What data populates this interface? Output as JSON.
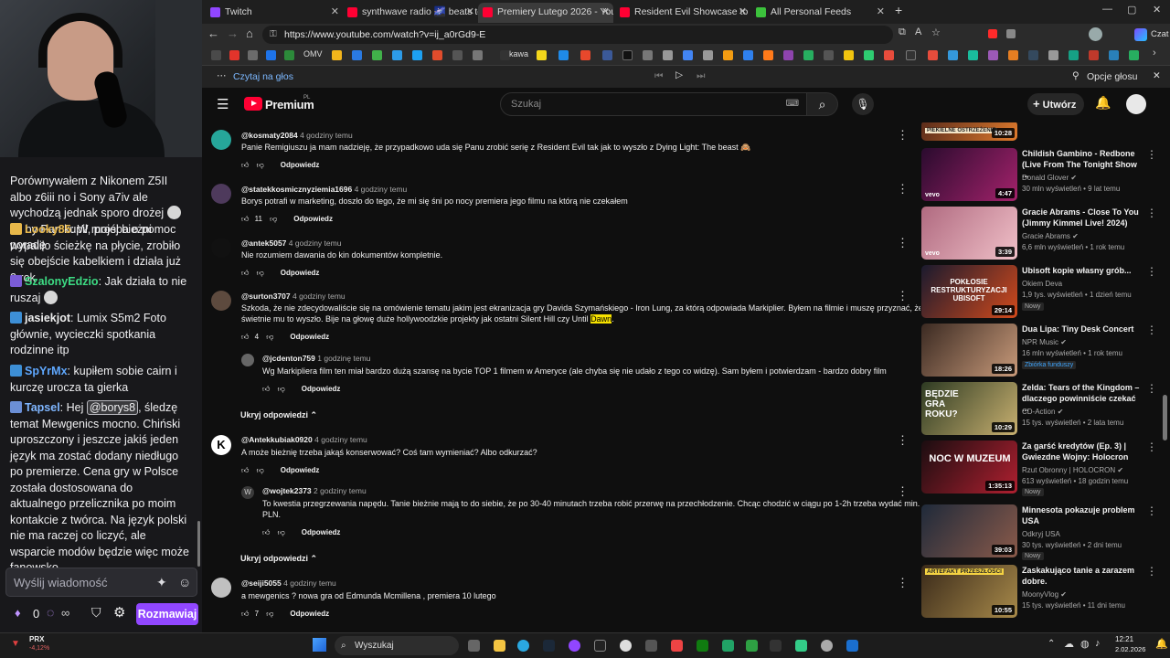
{
  "browser": {
    "tabs": [
      {
        "title": "Twitch",
        "color": "#9146ff"
      },
      {
        "title": "synthwave radio 🌌 beats to",
        "color": "#ff0033"
      },
      {
        "title": "Premiery Lutego 2026 - YouTube",
        "color": "#ff0033"
      },
      {
        "title": "Resident Evil Showcase to nieśmi",
        "color": "#ff0033"
      },
      {
        "title": "All Personal Feeds",
        "color": "#3cc23c"
      }
    ],
    "url": "https://www.youtube.com/watch?v=ij_a0rGd9-E",
    "bookmarks": [
      "OMV",
      "kawa"
    ],
    "read_aloud": "Czytaj na głos",
    "voice_options": "Opcje głosu",
    "profile_label": "Czat"
  },
  "twitch": {
    "chat": [
      {
        "user": "",
        "user_color": "#efeff1",
        "text": "Porównywałem z Nikonem Z5II albo z6iii no i Sony a7iv ale wychodzą jednak sporo drożej",
        "text2": " co by Pan kupił, prośba o pomoc poradę"
      },
      {
        "user": "Looky85",
        "user_color": "#e8b84a",
        "text": ": W mojej bieżni wypaliło ścieżkę na płycie, zrobiło się obejście kabelkiem i działa już 2 rok"
      },
      {
        "user": "SzalonyEdzio",
        "user_color": "#3ddc84",
        "text": ": Jak działa to nie ruszaj"
      },
      {
        "user": "jasiekjot",
        "user_color": "#eeeeee",
        "text": ": Lumix S5m2 Foto głównie, wycieczki spotkania rodzinne itp"
      },
      {
        "user": "SpYrMx",
        "user_color": "#5fa8ff",
        "text": ": kupiłem sobie cairn i kurczę urocza ta gierka"
      },
      {
        "user": "Tapsel",
        "user_color": "#7fb6ff",
        "text": ": Hej ",
        "mention": "@borys8",
        "text2": ", śledzę temat Mewgenics mocno. Chiński uproszczony i jeszcze jakiś jeden język ma zostać dodany niedługo po premierze. Cena gry w Polsce została dostosowana do aktualnego przelicznika po moim kontakcie z twórca. Na język polski nie ma raczej co liczyć, ale wsparcie modów będzie więc może fanowsko."
      }
    ],
    "input_placeholder": "Wyślij wiadomość",
    "points": "0",
    "chat_button": "Rozmawiaj"
  },
  "youtube": {
    "brand": "Premium",
    "brand_sup": "PL",
    "search_placeholder": "Szukaj",
    "create_label": "Utwórz",
    "comments": [
      {
        "author": "@kosmaty2084",
        "time": "4 godziny temu",
        "text": [
          "Panie Remigiuszu ja mam nadzieję, że przypadkowo uda się Panu zrobić serię z Resident Evil tak jak to wyszło z Dying Light: The beast 🙈"
        ],
        "likes": "",
        "reply": "Odpowiedz",
        "avatar": "#26a69a"
      },
      {
        "author": "@statekkosmicznyziemia1696",
        "time": "4 godziny temu",
        "text": [
          "Borys potrafi w marketing, doszło do tego, że mi się śni po nocy premiera jego filmu na którą nie czekałem"
        ],
        "likes": "11",
        "reply": "Odpowiedz",
        "avatar": "#4e3a5c"
      },
      {
        "author": "@antek5057",
        "time": "4 godziny temu",
        "text": [
          "Nie rozumiem dawania do kin dokumentów kompletnie."
        ],
        "likes": "",
        "reply": "Odpowiedz",
        "avatar": "#111111"
      },
      {
        "author": "@surton3707",
        "time": "4 godziny temu",
        "text": [
          "Szkoda, że nie zdecydowaliście się na omówienie tematu jakim jest ekranizacja gry Davida Szymańskiego - Iron Lung, za którą odpowiada Markiplier. Byłem na filmie i muszę przyznać, że",
          "świetnie mu to wyszło. Bije na głowę duże hollywoodzkie projekty jak ostatni Silent Hill czy Until "
        ],
        "highlight": "Dawn",
        "likes": "4",
        "reply": "Odpowiedz",
        "avatar": "#5d4a3e"
      },
      {
        "author": "@jcdenton759",
        "time": "1 godzinę temu",
        "text": [
          "Wg Markipliera film ten miał bardzo dużą szansę na bycie TOP 1 filmem w Ameryce (ale chyba się nie udało z tego co widzę). Sam byłem i potwierdzam - bardzo dobry film"
        ],
        "likes": "",
        "reply": "Odpowiedz",
        "avatar": "#666666"
      },
      {
        "author": "@Antekkubiak0920",
        "time": "4 godziny temu",
        "text": [
          "A może bieżnię trzeba jakąś konserwować? Coś tam wymieniać? Albo odkurzać?"
        ],
        "likes": "",
        "reply": "Odpowiedz",
        "avatar": "#ffffff",
        "letter": "K"
      },
      {
        "author": "@wojtek2373",
        "time": "2 godziny temu",
        "text": [
          "To kwestia przegrzewania napędu. Tanie bieżnie mają to do siebie, że po 30-40 minutach trzeba robić przerwę na przechłodzenie. Chcąc chodzić w ciągu po 1-2h trzeba wydać min. 4k",
          "PLN."
        ],
        "likes": "",
        "reply": "Odpowiedz",
        "avatar": "#3a3a3a",
        "letter": "W"
      },
      {
        "author": "@seiji5055",
        "time": "4 godziny temu",
        "text": [
          "a mewgenics ? nowa gra od Edmunda Mcmillena , premiera 10 lutego"
        ],
        "likes": "7",
        "reply": "Odpowiedz",
        "avatar": "#c0c0c0"
      }
    ],
    "hide_replies": "Ukryj odpowiedzi",
    "videos": [
      {
        "title": "",
        "channel": "",
        "meta": "",
        "duration": "10:28",
        "badge": "",
        "thumb": [
          "#5a2b1a",
          "#e07b2d"
        ],
        "caption": "PIEKIELNE OSTRZEŻENIE"
      },
      {
        "title": "Childish Gambino - Redbone (Live From The Tonight Show ...",
        "channel": "Donald Glover",
        "meta": "30 mln wyświetleń • 9 lat temu",
        "duration": "4:47",
        "badge": "",
        "thumb": [
          "#2a0b2e",
          "#a3226b"
        ],
        "caption": "vevo"
      },
      {
        "title": "Gracie Abrams - Close To You (Jimmy Kimmel Live! 2024)",
        "channel": "Gracie Abrams",
        "meta": "6,6 mln wyświetleń • 1 rok temu",
        "duration": "3:39",
        "badge": "",
        "thumb": [
          "#b06a80",
          "#f0c0c8"
        ],
        "caption": "vevo"
      },
      {
        "title": "Ubisoft kopie własny grób...",
        "channel": "Okiem Deva",
        "meta": "1,9 tys. wyświetleń • 1 dzień temu",
        "duration": "29:14",
        "badge": "Nowy",
        "thumb": [
          "#1a1a2e",
          "#d24a1c"
        ],
        "caption": "POKŁOSIE RESTRUKTURYZACJI UBISOFT"
      },
      {
        "title": "Dua Lipa: Tiny Desk Concert",
        "channel": "NPR Music",
        "meta": "16 mln wyświetleń • 1 rok temu",
        "duration": "18:26",
        "badge": "Zbiórka funduszy",
        "thumb": [
          "#3b2a22",
          "#c89a7a"
        ],
        "caption": ""
      },
      {
        "title": "Zelda: Tears of the Kingdom – dlaczego powinniście czekać ...",
        "channel": "CD-Action",
        "meta": "15 tys. wyświetleń • 2 lata temu",
        "duration": "10:29",
        "badge": "",
        "thumb": [
          "#2d3a22",
          "#c8b070"
        ],
        "caption": "BĘDZIE GRA ROKU?"
      },
      {
        "title": "Za garść kredytów (Ep. 3) | Gwiezdne Wojny: Holocron",
        "channel": "Rzut Obronny | HOLOCRON",
        "meta": "613 wyświetleń • 18 godzin temu",
        "duration": "1:35:13",
        "badge": "Nowy",
        "thumb": [
          "#1a0d10",
          "#b02030"
        ],
        "caption": "NOC W MUZEUM"
      },
      {
        "title": "Minnesota pokazuje problem USA",
        "channel": "Odkryj USA",
        "meta": "30 tys. wyświetleń • 2 dni temu",
        "duration": "39:03",
        "badge": "Nowy",
        "thumb": [
          "#1f2a3a",
          "#8a5a4a"
        ],
        "caption": ""
      },
      {
        "title": "Zaskakująco tanie a zarazem dobre.",
        "channel": "MoonyVlog",
        "meta": "15 tys. wyświetleń • 11 dni temu",
        "duration": "10:55",
        "badge": "",
        "thumb": [
          "#3a2a1a",
          "#a88a4a"
        ],
        "caption": "ARTEFAKT PRZESZŁOŚCI"
      }
    ]
  },
  "taskbar": {
    "ticker": "PRX",
    "ticker_change": "-4,12%",
    "search": "Wyszukaj",
    "time": "12:21",
    "date": "2.02.2026"
  }
}
